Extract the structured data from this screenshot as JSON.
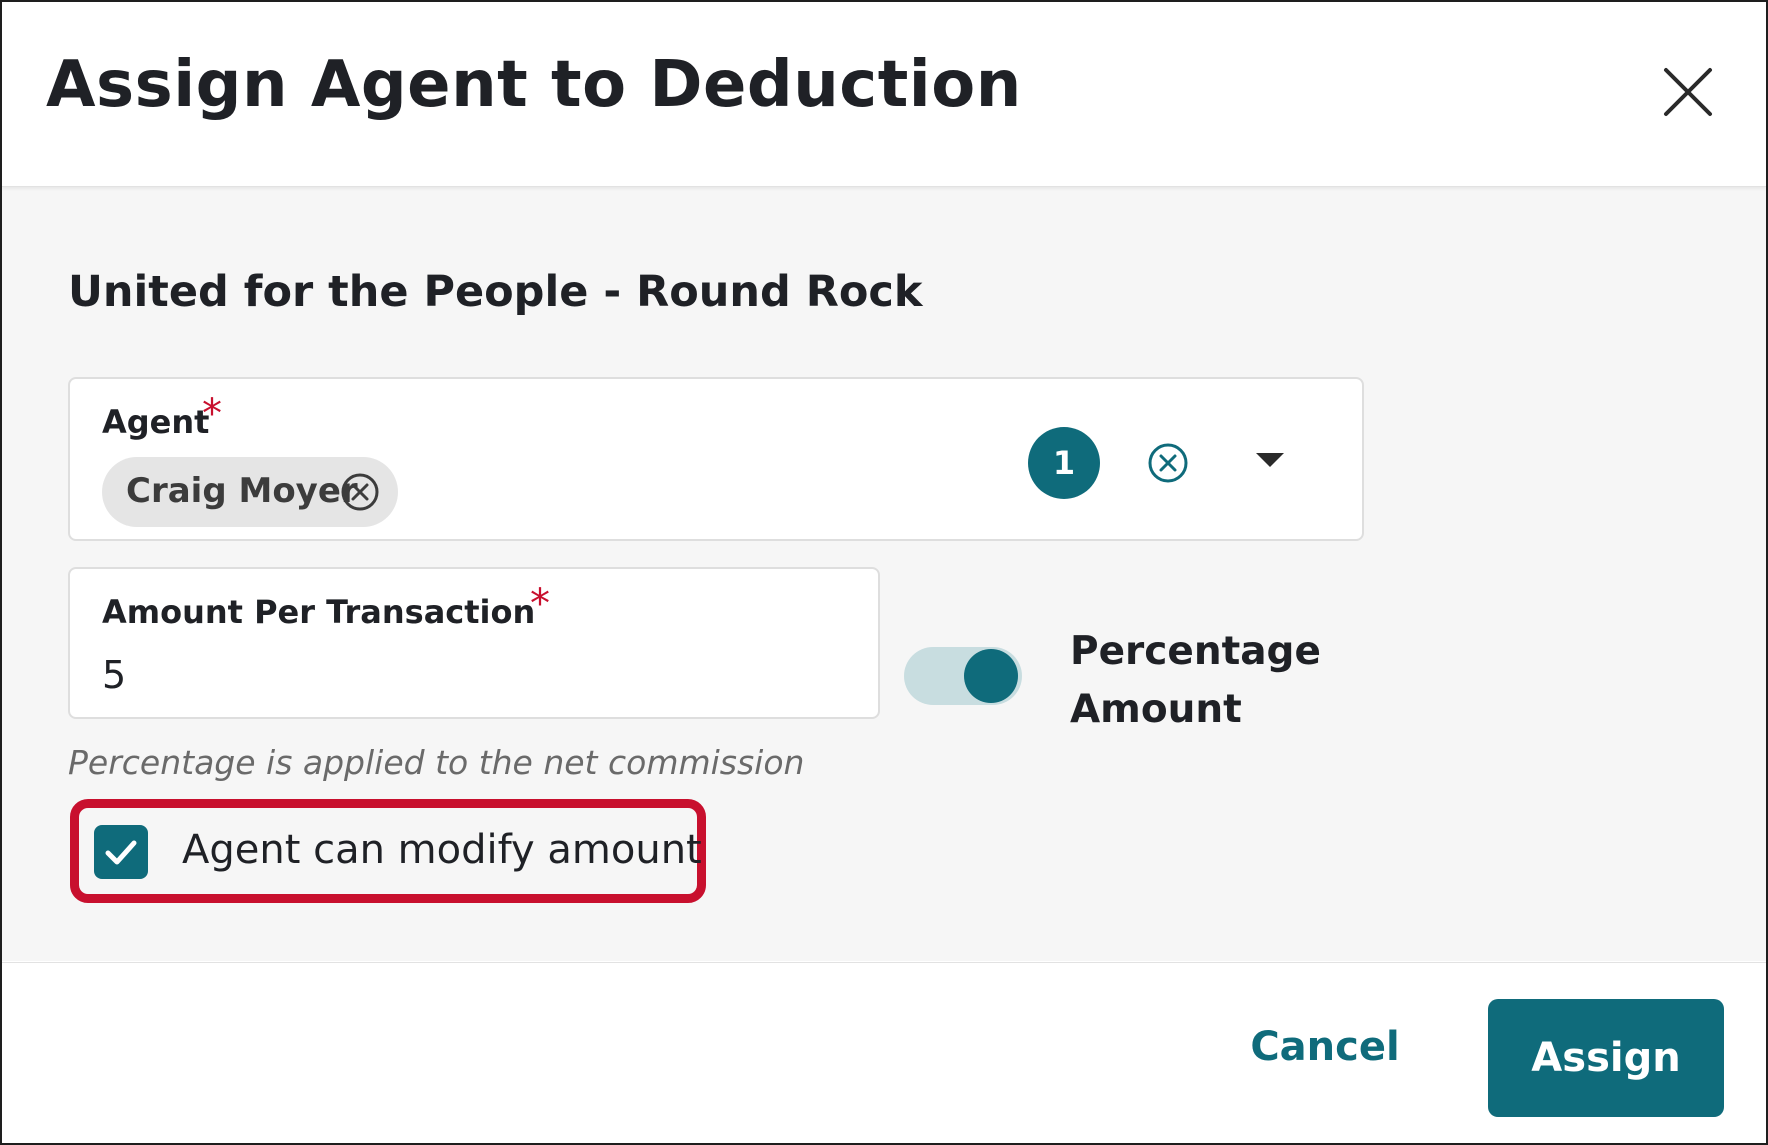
{
  "dialog": {
    "title": "Assign Agent to Deduction",
    "close_icon": "close-icon"
  },
  "form": {
    "subtitle": "United for the People - Round Rock",
    "agent": {
      "label": "Agent",
      "required_mark": "*",
      "selected": [
        "Craig Moyer"
      ],
      "selected_count": "1",
      "chip_remove_icon": "circle-x-icon",
      "clear_icon": "circle-x-icon",
      "dropdown_icon": "caret-down-icon"
    },
    "amount": {
      "label": "Amount Per Transaction",
      "required_mark": "*",
      "value": "5"
    },
    "toggle": {
      "label": "Percentage Amount",
      "checked": true
    },
    "hint": "Percentage is applied to the net commission",
    "modify_checkbox": {
      "label": "Agent can modify amount",
      "checked": true
    }
  },
  "footer": {
    "cancel_label": "Cancel",
    "assign_label": "Assign"
  },
  "colors": {
    "primary": "#0f6b7b",
    "required": "#c8102e",
    "highlight": "#c8102e",
    "toggle_track": "#c8dde0",
    "body_bg": "#f6f6f6"
  }
}
